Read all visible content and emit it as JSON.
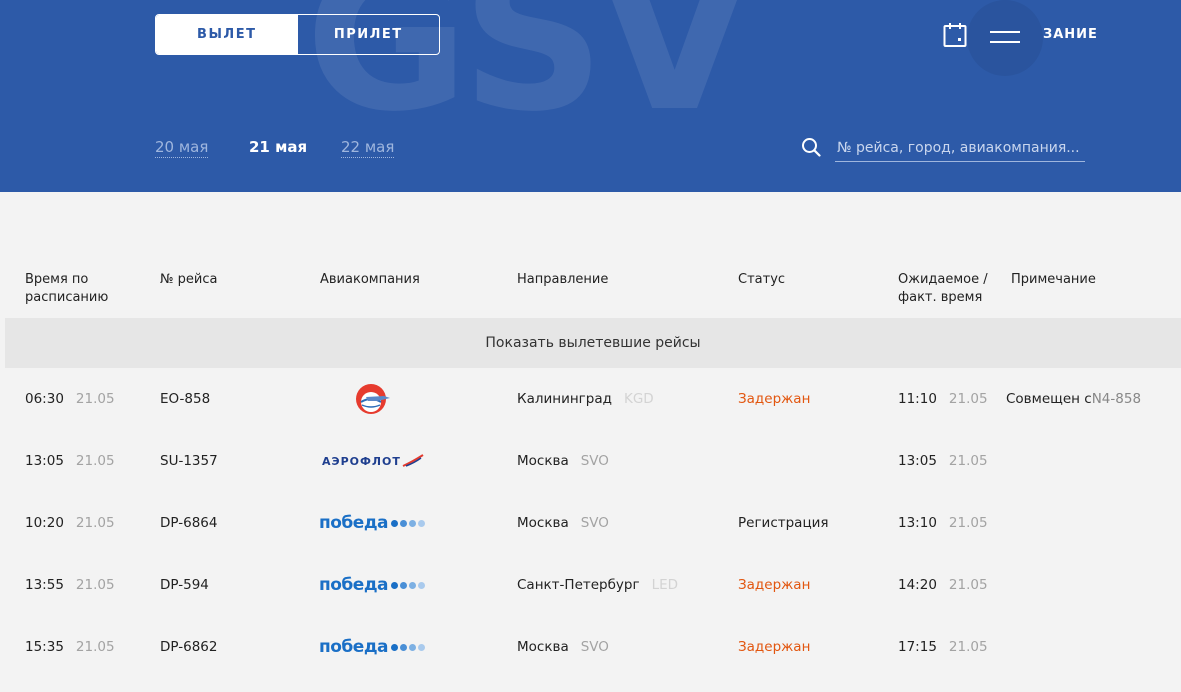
{
  "header": {
    "watermark": "GSV",
    "tabs": [
      {
        "label": "ВЫЛЕТ",
        "active": true
      },
      {
        "label": "ПРИЛЕТ",
        "active": false
      }
    ],
    "schedule_label": "ЗАНИЕ",
    "icons": {
      "calendar": "calendar-icon",
      "menu": "hamburger-icon",
      "search": "search-icon"
    },
    "dates": [
      {
        "label": "20 мая",
        "current": false
      },
      {
        "label": "21 мая",
        "current": true
      },
      {
        "label": "22 мая",
        "current": false
      }
    ],
    "search": {
      "placeholder": "№ рейса, город, авиакомпания..."
    }
  },
  "table": {
    "columns": {
      "scheduled": "Время по расписанию",
      "flight": "№ рейса",
      "airline": "Авиакомпания",
      "destination": "Направление",
      "status": "Статус",
      "actual": "Ожидаемое / факт. время",
      "note": "Примечание"
    },
    "show_departed": "Показать вылетевшие рейсы",
    "rows": [
      {
        "time": "06:30",
        "date": "21.05",
        "flight": "EO-858",
        "airline": "ikar",
        "city": "Калининград",
        "code": "KGD",
        "status": "Задержан",
        "status_type": "delayed",
        "actual_time": "11:10",
        "actual_date": "21.05",
        "note_prefix": "Совмещен с ",
        "note_code": "N4-858"
      },
      {
        "time": "13:05",
        "date": "21.05",
        "flight": "SU-1357",
        "airline": "aeroflot",
        "city": "Москва",
        "code": "SVO",
        "status": "",
        "status_type": "none",
        "actual_time": "13:05",
        "actual_date": "21.05",
        "note_prefix": "",
        "note_code": ""
      },
      {
        "time": "10:20",
        "date": "21.05",
        "flight": "DP-6864",
        "airline": "pobeda",
        "city": "Москва",
        "code": "SVO",
        "status": "Регистрация",
        "status_type": "normal",
        "actual_time": "13:10",
        "actual_date": "21.05",
        "note_prefix": "",
        "note_code": ""
      },
      {
        "time": "13:55",
        "date": "21.05",
        "flight": "DP-594",
        "airline": "pobeda",
        "city": "Санкт-Петербург",
        "code": "LED",
        "status": "Задержан",
        "status_type": "delayed",
        "actual_time": "14:20",
        "actual_date": "21.05",
        "note_prefix": "",
        "note_code": ""
      },
      {
        "time": "15:35",
        "date": "21.05",
        "flight": "DP-6862",
        "airline": "pobeda",
        "city": "Москва",
        "code": "SVO",
        "status": "Задержан",
        "status_type": "delayed",
        "actual_time": "17:15",
        "actual_date": "21.05",
        "note_prefix": "",
        "note_code": ""
      }
    ]
  },
  "logos": {
    "aeroflot_text": "АЭРОФЛОТ",
    "pobeda_text": "победа"
  },
  "colors": {
    "header_bg": "#2d5aa8",
    "delayed": "#e2560f",
    "pobeda": "#1a6fc6"
  }
}
